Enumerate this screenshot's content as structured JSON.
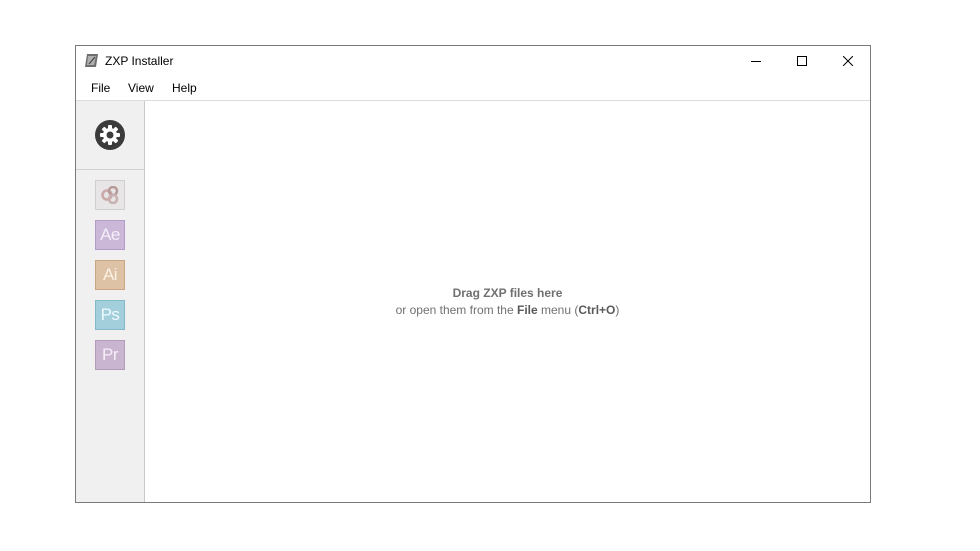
{
  "window": {
    "title": "ZXP Installer"
  },
  "menubar": {
    "items": [
      "File",
      "View",
      "Help"
    ]
  },
  "sidebar": {
    "settings_icon": "gear-icon",
    "apps": [
      {
        "name": "creative-cloud",
        "label": "",
        "icon": "creative-cloud-icon",
        "color": "#e7e5e5"
      },
      {
        "name": "after-effects",
        "label": "Ae",
        "color": "#cbb8d8"
      },
      {
        "name": "illustrator",
        "label": "Ai",
        "color": "#ddc2a6"
      },
      {
        "name": "photoshop",
        "label": "Ps",
        "color": "#a3cfdc"
      },
      {
        "name": "premiere",
        "label": "Pr",
        "color": "#c9b5cf"
      }
    ]
  },
  "main": {
    "drop_title": "Drag ZXP files here",
    "drop_sub_prefix": "or open them from the",
    "drop_sub_menu": "File",
    "drop_sub_middle": "menu (",
    "drop_sub_shortcut": "Ctrl+O",
    "drop_sub_suffix": ")"
  }
}
